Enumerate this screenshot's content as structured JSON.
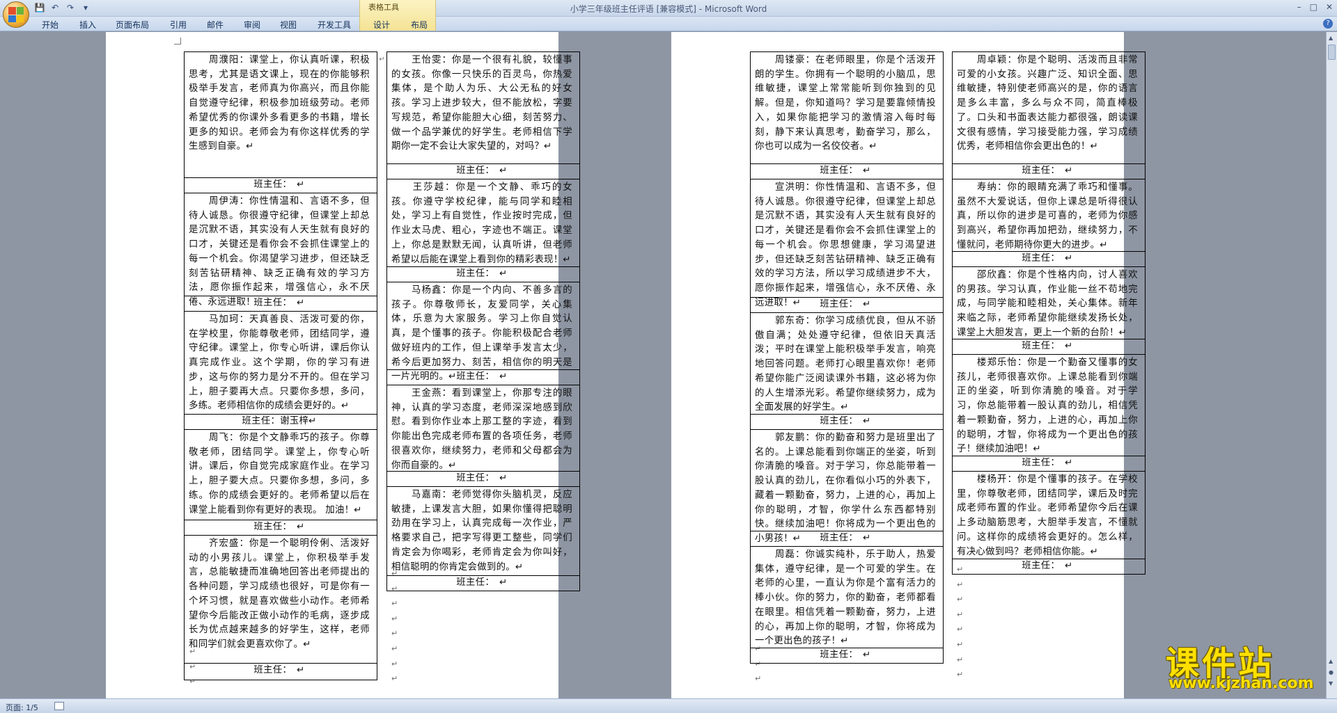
{
  "window": {
    "title": "小学三年级班主任评语 [兼容模式] - Microsoft Word",
    "context_tab_group": "表格工具"
  },
  "quick_access": {
    "icons": [
      "save-icon",
      "undo-icon",
      "redo-icon",
      "customize-dropdown-icon"
    ]
  },
  "ribbon": {
    "tabs": [
      {
        "label": "开始"
      },
      {
        "label": "插入"
      },
      {
        "label": "页面布局"
      },
      {
        "label": "引用"
      },
      {
        "label": "邮件"
      },
      {
        "label": "审阅"
      },
      {
        "label": "视图"
      },
      {
        "label": "开发工具"
      },
      {
        "label": "设计"
      },
      {
        "label": "布局"
      }
    ]
  },
  "statusbar": {
    "page_indicator": "页面: 1/5"
  },
  "watermark": {
    "text": "课件站",
    "url": "www.kjzhan.com",
    "color": "#ffe000"
  },
  "sign_label": "班主任：",
  "pages": [
    {
      "columns": [
        {
          "cells": [
            {
              "body": "　　周濮阳：课堂上，你认真听课，积极思考，尤其是语文课上，现在的你能够积极举手发言，老师真为你高兴，而且你能自觉遵守纪律，积极参加班级劳动。老师希望优秀的你课外多看更多的书籍，增长更多的知识。老师会为有你这样优秀的学生感到自豪。↵",
              "sign": "班主任：　↵"
            },
            {
              "body": "　　周伊涛：你性情温和、言语不多，但待人诚恳。你很遵守纪律，但课堂上却总是沉默不语，其实没有人天生就有良好的口才，关键还是看你会不会抓住课堂上的每一个机会。你渴望学习进步，但还缺乏刻苦钻研精神、缺乏正确有效的学习方法，愿你振作起来，增强信心，永不厌倦、永远进取！",
              "sign": "班主任：　↵"
            },
            {
              "body": "　　马加珂：天真善良、活泼可爱的你，在学校里，你能尊敬老师，团结同学，遵守纪律。课堂上，你专心听讲，课后你认真完成作业。这个学期，你的学习有进步，这与你的努力是分不开的。但在学习上，胆子要再大点。只要你多想，多问，多练。老师相信你的成绩会更好的。↵",
              "sign": "班主任：谢玉梓↵"
            },
            {
              "body": "　　周飞：你是个文静乖巧的孩子。你尊敬老师，团结同学。课堂上，你专心听讲。课后，你自觉完成家庭作业。在学习上，胆子要大点。只要你多想，多问，多练。你的成绩会更好的。老师希望以后在课堂上能看到你有更好的表现。 加油！↵",
              "sign": "班主任：　↵"
            },
            {
              "body": "　　齐宏盛：你是一个聪明伶俐、活泼好动的小男孩儿。课堂上，你积极举手发言，总能敏捷而准确地回答出老师提出的各种问题，学习成绩也很好，可是你有一个坏习惯，就是喜欢做些小动作。老师希望你今后能改正做小动作的毛病，逐步成长为优点越来越多的好学生，这样，老师和同学们就会更喜欢你了。↵",
              "sign": "班主任：　↵"
            }
          ]
        },
        {
          "cells": [
            {
              "body": "　　王怡雯：你是一个很有礼貌，较懂事的女孩。你像一只快乐的百灵鸟，你热爱集体，是个助人为乐、大公无私的好女孩。学习上进步较大，但不能放松，字要写规范，希望你能胆大心细，刻苦努力、做一个品学兼优的好学生。老师相信下学期你一定不会让大家失望的，对吗？↵",
              "sign": "班主任：　↵"
            },
            {
              "body": "　　王莎越：你是一个文静、乖巧的女孩。你遵守学校纪律，能与同学和睦相处，学习上有自觉性，作业按时完成，但作业太马虎、粗心，字迹也不端正。课堂上，你总是默默无闻，认真听讲，但老师希望以后能在课堂上看到你的精彩表现！↵",
              "sign": "班主任：　↵"
            },
            {
              "body": "　　马杨鑫：你是一个内向、不善多言的孩子。你尊敬师长，友爱同学，关心集体，乐意为大家服务。学习上你自觉认真，是个懂事的孩子。你能积极配合老师做好班内的工作，但上课举手发言太少，希今后更加努力、刻苦，相信你的明天是一片光明的。↵",
              "sign": "班主任：　↵"
            },
            {
              "body": "　　王金燕：看到课堂上，你那专注的眼神，认真的学习态度，老师深深地感到欣慰。看到你作业本上那工整的字迹，看到你能出色完成老师布置的各项任务，老师很喜欢你，继续努力，老师和父母都会为你而自豪的。↵",
              "sign": "班主任：　↵"
            },
            {
              "body": "　　马嘉南：老师觉得你头脑机灵，反应敏捷，上课发言大胆，如果你懂得把聪明劲用在学习上，认真完成每一次作业，严格要求自己，把字写得更工整些，同学们肯定会为你喝彩，老师肯定会为你叫好，相信聪明的你肯定会做到的。↵",
              "sign": "班主任：　↵"
            }
          ]
        }
      ]
    },
    {
      "columns": [
        {
          "cells": [
            {
              "body": "　　周镂豪：在老师眼里，你是个活泼开朗的学生。你拥有一个聪明的小脑瓜，思维敏捷，课堂上常常能听到你独到的见解。但是，你知道吗？学习是要靠倾情投入，如果你能把学习的激情溶入每时每刻，静下来认真思考，勤奋学习，那么，你也可以成为一名佼佼者。↵",
              "sign": "班主任：　↵"
            },
            {
              "body": "　　宣洪明：你性情温和、言语不多，但待人诚恳。你很遵守纪律，但课堂上却总是沉默不语，其实没有人天生就有良好的口才，关键还是看你会不会抓住课堂上的每一个机会。你思想健康，学习渴望进步，但还缺乏刻苦钻研精神、缺乏正确有效的学习方法，所以学习成绩进步不大，愿你振作起来，增强信心，永不厌倦、永远进取！↵",
              "sign": "班主任：　↵"
            },
            {
              "body": "　　郭东奇：你学习成绩优良，但从不骄傲自满；处处遵守纪律，但依旧天真活泼；平时在课堂上能积极举手发言，响亮地回答问题。老师打心眼里喜欢你！老师希望你能广泛阅读课外书籍，这必将为你的人生增添光彩。希望你继续努力，成为全面发展的好学生。↵",
              "sign": "班主任：　↵"
            },
            {
              "body": "　　郭友鹏：你的勤奋和努力是班里出了名的。上课总能看到你端正的坐姿，听到你清脆的嗓音。对于学习，你总能带着一股认真的劲儿，在你看似小巧的外表下，藏着一颗勤奋，努力，上进的心，再加上你的聪明，才智，你学什么东西都特别快。继续加油吧！你将成为一个更出色的小男孩！↵",
              "sign": "班主任：　↵"
            },
            {
              "body": "　　周磊：你诚实纯朴，乐于助人，热爱集体，遵守纪律，是一个可爱的学生。在老师的心里，一直认为你是个富有活力的棒小伙。你的努力，你的勤奋，老师都看在眼里。相信凭着一颗勤奋，努力，上进的心，再加上你的聪明，才智，你将成为一个更出色的孩子！↵",
              "sign": "班主任：　↵"
            }
          ]
        },
        {
          "cells": [
            {
              "body": "　　周卓颖：你是个聪明、活泼而且非常可爱的小女孩。兴趣广泛、知识全面、思维敏捷，特别使老师高兴的是，你的语言是多么丰富，多么与众不同，简直棒极了。口头和书面表达能力都很强，朗读课文很有感情，学习接受能力强，学习成绩优秀，老师相信你会更出色的！↵",
              "sign": "班主任：　↵"
            },
            {
              "body": "　　寿纳：你的眼睛充满了乖巧和懂事。虽然不大爱说话，但你上课总是听得很认真，所以你的进步是可喜的，老师为你感到高兴，希望你再加把劲，继续努力，不懂就问，老师期待你更大的进步。↵",
              "sign": "班主任：　↵"
            },
            {
              "body": "　　邵欣鑫：你是个性格内向，讨人喜欢的男孩。学习认真，作业能一丝不苟地完成，与同学能和睦相处，关心集体。新年来临之际，老师希望你能继续发扬长处，课堂上大胆发言，更上一个新的台阶！↵",
              "sign": "班主任：　↵"
            },
            {
              "body": "　　楼郑乐怡：你是一个勤奋又懂事的女孩儿，老师很喜欢你。上课总能看到你端正的坐姿，听到你清脆的嗓音。对于学习，你总能带着一股认真的劲儿，相信凭着一颗勤奋，努力，上进的心，再加上你的聪明，才智，你将成为一个更出色的孩子！继续加油吧！↵",
              "sign": "班主任：　↵"
            },
            {
              "body": "　　楼杨开：你是个懂事的孩子。在学校里，你尊敬老师，团结同学，课后及时完成老师布置的作业。老师希望你今后在课上多动脑筋思考，大胆举手发言，不懂就问。这样你的成绩将会更好的。怎么样，有决心做到吗？老师相信你能。↵",
              "sign": "班主任：　↵"
            }
          ]
        }
      ]
    }
  ]
}
